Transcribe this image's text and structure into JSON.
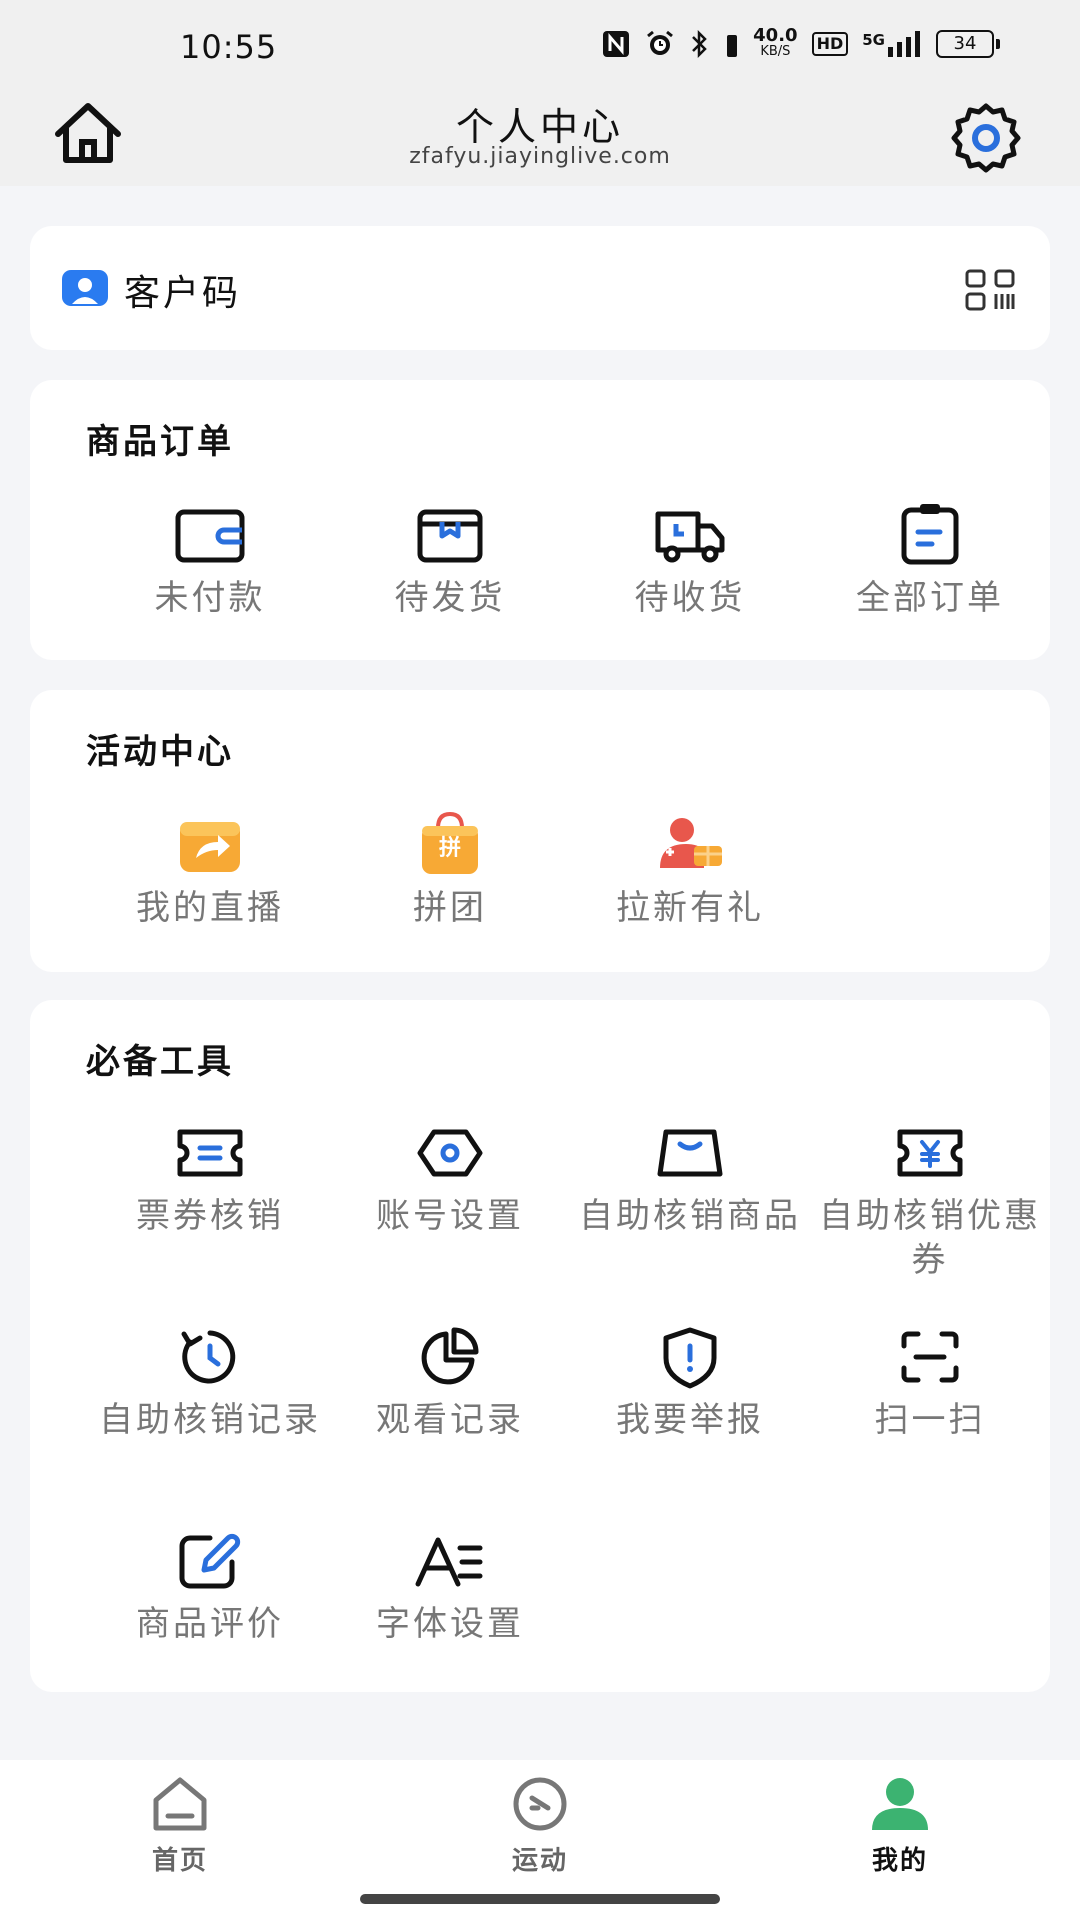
{
  "status_bar": {
    "time": "10:55",
    "speed_value": "40.0",
    "speed_unit": "KB/S",
    "hd": "HD",
    "network": "5G",
    "battery": "34"
  },
  "header": {
    "title": "个人中心",
    "subtitle": "zfafyu.jiayinglive.com"
  },
  "customer_code": {
    "label": "客户码"
  },
  "orders": {
    "title": "商品订单",
    "items": [
      {
        "label": "未付款",
        "icon": "wallet-icon"
      },
      {
        "label": "待发货",
        "icon": "box-icon"
      },
      {
        "label": "待收货",
        "icon": "truck-icon"
      },
      {
        "label": "全部订单",
        "icon": "clipboard-icon"
      }
    ]
  },
  "activities": {
    "title": "活动中心",
    "items": [
      {
        "label": "我的直播",
        "icon": "live-share-icon"
      },
      {
        "label": "拼团",
        "icon": "group-buy-bag-icon"
      },
      {
        "label": "拉新有礼",
        "icon": "invite-gift-icon"
      }
    ],
    "badge_text": "拼"
  },
  "tools": {
    "title": "必备工具",
    "items": [
      {
        "label": "票券核销",
        "icon": "ticket-icon"
      },
      {
        "label": "账号设置",
        "icon": "hexagon-settings-icon"
      },
      {
        "label": "自助核销商品",
        "icon": "bag-icon"
      },
      {
        "label": "自助核销优惠券",
        "icon": "coupon-yuan-icon"
      },
      {
        "label": "自助核销记录",
        "icon": "history-clock-icon"
      },
      {
        "label": "观看记录",
        "icon": "pie-chart-icon"
      },
      {
        "label": "我要举报",
        "icon": "shield-alert-icon"
      },
      {
        "label": "扫一扫",
        "icon": "scan-icon"
      },
      {
        "label": "商品评价",
        "icon": "edit-pen-icon"
      },
      {
        "label": "字体设置",
        "icon": "font-icon"
      }
    ]
  },
  "tabbar": {
    "items": [
      {
        "label": "首页",
        "icon": "home-tab-icon",
        "active": false
      },
      {
        "label": "运动",
        "icon": "sport-tab-icon",
        "active": false
      },
      {
        "label": "我的",
        "icon": "profile-tab-icon",
        "active": true
      }
    ]
  },
  "colors": {
    "accent": "#2a6fdc",
    "active_tab": "#3cb371",
    "orange": "#f7a935",
    "red": "#e8574c"
  }
}
